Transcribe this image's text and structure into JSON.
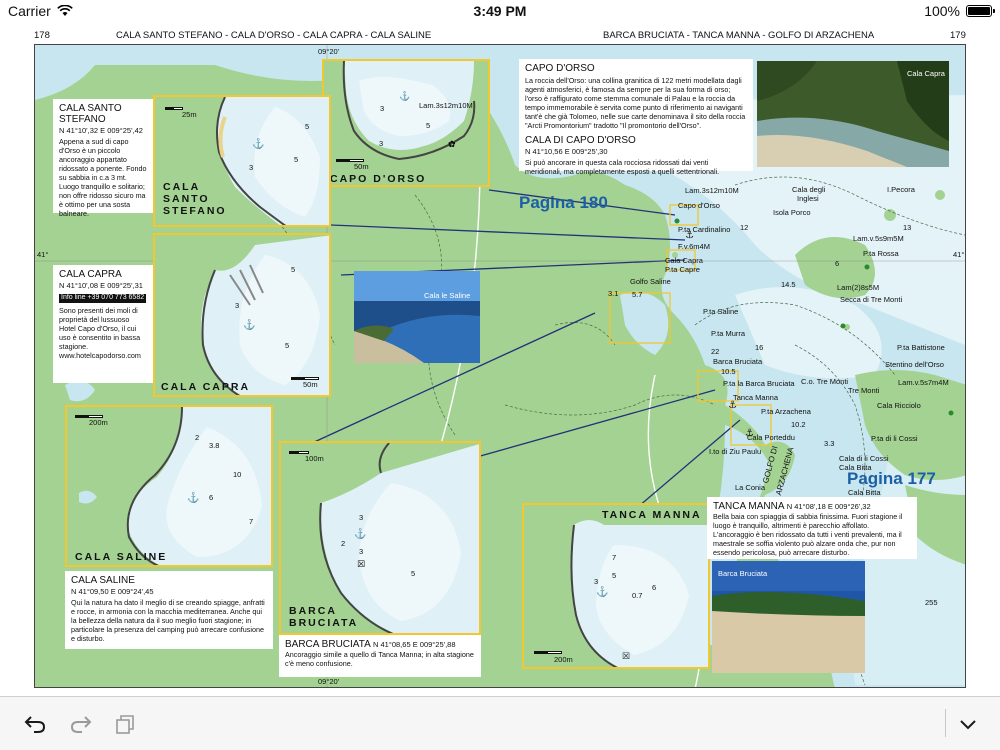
{
  "status": {
    "carrier": "Carrier",
    "time": "3:49 PM",
    "battery": "100%",
    "battery_level": 1.0
  },
  "header": {
    "page_left": "178",
    "title_left": "CALA SANTO STEFANO - CALA D'ORSO - CALA CAPRA - CALA SALINE",
    "title_right": "BARCA BRUCIATA - TANCA MANNA - GOLFO DI ARZACHENA",
    "page_right": "179"
  },
  "grid": {
    "top_lon": "09°20'",
    "bottom_lon": "09°20'",
    "left_lat": "41°",
    "right_lat": "41°"
  },
  "pagina": {
    "p180": "Pagina 180",
    "p177": "Pagina 177"
  },
  "places": {
    "lam_orso": "Lam.3s12m10M",
    "capo_orso": "Capo d'Orso",
    "cala_inglesi_1": "Cala degli",
    "cala_inglesi_2": "Inglesi",
    "pecora": "I.Pecora",
    "isola_porco": "Isola Porco",
    "cardinalino": "P.ta Cardinalino",
    "fv": "F.v.6m4M",
    "cala_capra": "Cala Capra",
    "pta_capre": "P.ta Capre",
    "golfo_saline": "Golfo Saline",
    "lam_v5s": "Lam.v.5s9m5M",
    "pta_rossa": "P.ta Rossa",
    "lam_secca": "Lam(2)8s5M",
    "secca": "Secca di Tre Monti",
    "pta_saline": "P.ta Saline",
    "pta_murra": "P.ta Murra",
    "pta_battistone": "P.ta Battistone",
    "stentino": "Stentino dell'Orso",
    "barca_bruciata": "Barca Bruciata",
    "pta_barca": "P.ta la Barca Bruciata",
    "co_tre_monti": "C.o. Tre Monti",
    "tre_monti": "Tre Monti",
    "lam_v5s7": "Lam.v.5s7m4M",
    "tanca_manna": "Tanca Manna",
    "pta_arzachena": "P.ta Arzachena",
    "cala_ricciolo": "Cala Ricciolo",
    "cala_porteddu": "Cala Porteddu",
    "pta_cossi": "P.ta di li Cossi",
    "cala_cossi": "Cala di li Cossi",
    "cala_bitta_1": "Cala Bitta",
    "cala_bitta_2": "Cala Bitta",
    "ziu_paulu": "I.to di Ziu Paulu",
    "golfo_arzachena_1": "GOLFO DI",
    "golfo_arzachena_2": "ARZACHENA",
    "la_conia": "La Conia",
    "depth_255": "255",
    "depth_3": "3.1",
    "depth_57": "5.7",
    "depth_22": "22",
    "depth_105": "10.5",
    "depth_102": "10.2",
    "depth_33": "3.3",
    "depth_145": "14.5",
    "depth_13": "13",
    "depth_16": "16",
    "depth_12": "12",
    "depth_6": "6"
  },
  "insets": {
    "capo_orso": {
      "title": "CAPO D'ORSO",
      "lam": "Lam.3s12m10M",
      "scale": "50m",
      "d1": "3",
      "d2": "5",
      "d3": "3"
    },
    "santo_stefano": {
      "title_1": "CALA",
      "title_2": "SANTO",
      "title_3": "STEFANO",
      "scale": "25m",
      "d1": "5",
      "d2": "3",
      "d3": "5"
    },
    "capra": {
      "title": "CALA CAPRA",
      "scale": "50m",
      "d1": "5",
      "d2": "3",
      "d3": "5"
    },
    "saline": {
      "title": "CALA SALINE",
      "scale": "200m",
      "d1": "2",
      "d2": "3.8",
      "d3": "10",
      "d4": "6",
      "d5": "7"
    },
    "barca": {
      "title_1": "BARCA",
      "title_2": "BRUCIATA",
      "scale": "100m",
      "d1": "3",
      "d2": "5",
      "d3": "2",
      "d4": "3"
    },
    "tanca": {
      "title": "TANCA MANNA",
      "scale": "200m",
      "d1": "7",
      "d2": "5",
      "d3": "3",
      "d4": "6",
      "d5": "0.7"
    }
  },
  "descriptions": {
    "santo_stefano": {
      "title": "CALA SANTO STEFANO",
      "coord": "N 41°10',32 E 009°25',42",
      "text": "Appena a sud di capo d'Orso è un piccolo ancoraggio appartato ridossato a ponente. Fondo su sabbia in c.a 3 mt. Luogo tranquillo e solitario; non offre ridosso sicuro ma è ottimo per una sosta balneare."
    },
    "capra": {
      "title": "CALA CAPRA",
      "coord": "N 41°10',08 E 009°25',31",
      "info": "Info line +39 070 773 6582",
      "text": "Sono presenti dei moli di proprietà del lussuoso Hotel Capo d'Orso, il cui uso è consentito in bassa stagione. www.hotelcapodorso.com"
    },
    "capo_orso": {
      "title": "CAPO D'ORSO",
      "text": "La roccia dell'Orso: una collina granitica di 122 metri modellata dagli agenti atmosferici, è famosa da sempre per la sua forma di orso; l'orso è raffigurato come stemma comunale di Palau e la roccia da tempo immemorabile è servita come punto di riferimento ai naviganti tant'è che già Tolomeo, nelle sue carte denominava il sito della roccia \"Arcti Promontorium\" tradotto \"Il promontorio dell'Orso\".",
      "title2": "CALA DI CAPO D'ORSO",
      "coord2": "N 41°10,56 E 009°25',30",
      "text2": "Si può ancorare in questa cala rocciosa ridossati dai venti meridionali, ma completamente esposti a quelli settentrionali."
    },
    "saline": {
      "title": "CALA SALINE",
      "coord": "N 41°09,50 E 009°24',45",
      "text": "Qui la natura ha dato il meglio di se creando spiagge, anfratti e rocce, in armonia con la macchia mediterranea. Anche qui la bellezza della natura da il suo meglio fuori stagione; in particolare la presenza del camping può arrecare confusione e disturbo."
    },
    "barca": {
      "title": "BARCA BRUCIATA",
      "coord": "N 41°08,65 E 009°25',88",
      "text": "Ancoraggio simile a quello di Tanca Manna; in alta stagione c'è meno confusione."
    },
    "tanca": {
      "title": "TANCA MANNA",
      "coord": "N 41°08',18 E 009°26',32",
      "text": "Bella baia con spiaggia di sabbia finissima. Fuori stagione il luogo è tranquillo, altrimenti è parecchio affollato. L'ancoraggio è ben ridossato da tutti i venti prevalenti, ma il maestrale se soffia violento può alzare onda che, pur non essendo pericolosa, può arrecare disturbo."
    }
  },
  "photos": {
    "cala_capra": "Cala Capra",
    "cala_saline": "Cala le Saline",
    "barca_bruciata": "Barca Bruciata"
  },
  "toolbar": {
    "undo": "undo",
    "redo": "redo",
    "copy": "copy",
    "collapse": "collapse"
  },
  "colors": {
    "land": "#a3d292",
    "sea_shallow": "#c8e6ef",
    "sea_deep": "#e4f3f8",
    "frame": "#f2c730",
    "pagina": "#1d5fa6"
  }
}
